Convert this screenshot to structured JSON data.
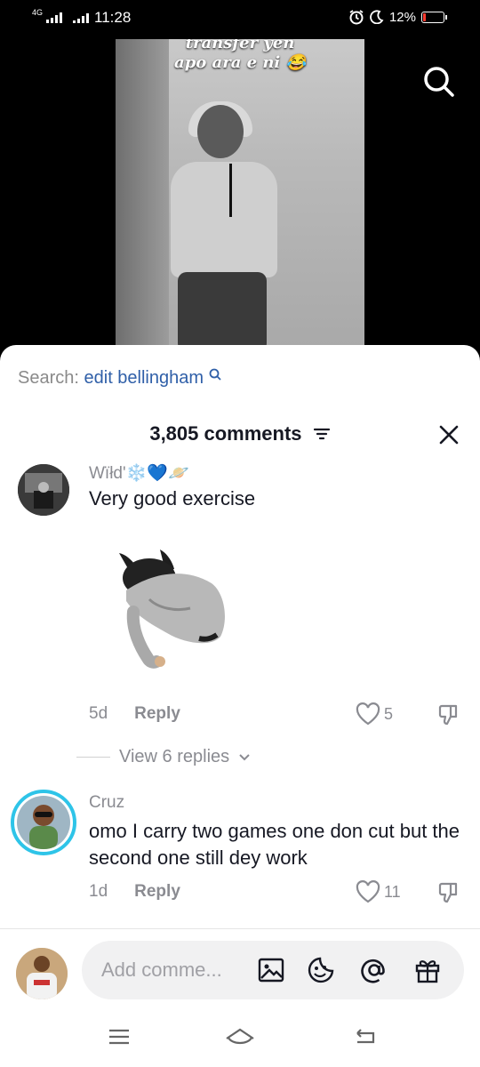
{
  "status_bar": {
    "network": "4G",
    "time": "11:28",
    "battery_percent": "12%",
    "battery_level": 0.12
  },
  "video": {
    "caption_line1": "transfer yen",
    "caption_line2": "apo ara e ni 😂"
  },
  "search_hint": {
    "prefix": "Search:",
    "query": "edit bellingham"
  },
  "comments_header": {
    "count_label": "3,805 comments"
  },
  "comments": [
    {
      "username": "Wïłd'❄️💙🪐",
      "text": "Very good exercise",
      "age": "5d",
      "reply_label": "Reply",
      "likes": "5",
      "view_replies": "View 6 replies"
    },
    {
      "username": "Cruz",
      "text": "omo I carry two games one don cut but the second one still dey work",
      "age": "1d",
      "reply_label": "Reply",
      "likes": "11"
    }
  ],
  "input": {
    "placeholder": "Add comme..."
  },
  "colors": {
    "accent_blue": "#2f5fa8",
    "text_dark": "#161823",
    "text_muted": "#8a8b91",
    "battery_red": "#ff3b30",
    "story_ring": "#2ec4e8"
  }
}
